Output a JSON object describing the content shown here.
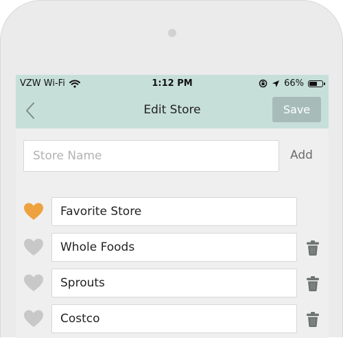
{
  "status_bar": {
    "carrier": "VZW Wi-Fi",
    "time": "1:12 PM",
    "battery": "66%",
    "battery_level": 0.66
  },
  "nav": {
    "title": "Edit Store",
    "save_label": "Save"
  },
  "add_store": {
    "placeholder": "Store Name",
    "add_label": "Add"
  },
  "colors": {
    "header_bg": "#c7dfd9",
    "favorite_heart": "#eea23f",
    "inactive_heart": "#c8c8c8",
    "save_button": "#a7bcb8"
  },
  "stores": [
    {
      "name": "Favorite Store",
      "favorite": true,
      "deletable": false
    },
    {
      "name": "Whole Foods",
      "favorite": false,
      "deletable": true
    },
    {
      "name": "Sprouts",
      "favorite": false,
      "deletable": true
    },
    {
      "name": "Costco",
      "favorite": false,
      "deletable": true
    }
  ]
}
